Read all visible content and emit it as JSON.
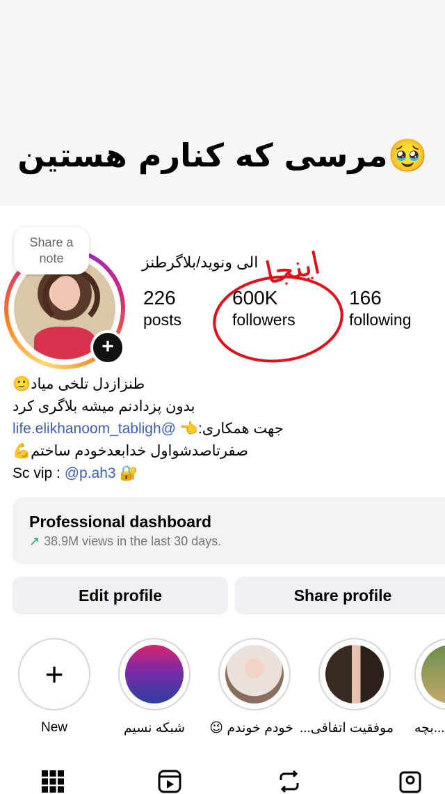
{
  "banner": {
    "title": "🥹مرسی که کنارم هستین"
  },
  "profile": {
    "note_line1": "Share a",
    "note_line2": "note",
    "username": "الی ونوید/بلاگرطنز",
    "stats": [
      {
        "value": "226",
        "label": "posts"
      },
      {
        "value": "600K",
        "label": "followers"
      },
      {
        "value": "166",
        "label": "following"
      }
    ],
    "annotation": "اینجا"
  },
  "bio": {
    "line1": "طنزازدل تلخی میاد🙂",
    "line2": "بدون پزدادنم میشه بلاگری کرد",
    "line3_prefix": "جهت همکاری:👈",
    "line3_link": "life.elikhanoom_tabligh@",
    "line4": "صفرتاصدشواول خدابعدخودم ساختم💪",
    "line5_prefix": "Sc vip : ",
    "line5_link": "@p.ah3",
    "line5_suffix": " 🔐"
  },
  "dashboard": {
    "title": "Professional dashboard",
    "subtitle": "38.9M views in the last 30 days."
  },
  "actions": {
    "edit": "Edit profile",
    "share": "Share profile"
  },
  "highlights": [
    {
      "label": "New"
    },
    {
      "label": "شبکه نسیم"
    },
    {
      "label": "خودم خوندم 😉"
    },
    {
      "label": "موفقیت اتفاقی..."
    },
    {
      "label": "...بچه"
    }
  ],
  "colors": {
    "link": "#3c5bb4",
    "trend": "#20a05a",
    "annotation_red": "#e0101a"
  }
}
